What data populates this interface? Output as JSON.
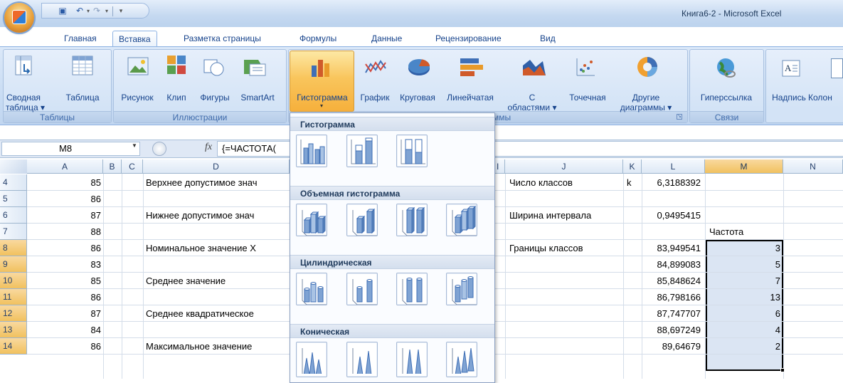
{
  "window": {
    "title": "Книга6-2 - Microsoft Excel"
  },
  "quick_access": [
    "save-icon",
    "undo-icon",
    "redo-icon",
    "customize-icon"
  ],
  "tabs": [
    {
      "label": "Главная",
      "active": false
    },
    {
      "label": "Вставка",
      "active": true
    },
    {
      "label": "Разметка страницы",
      "active": false
    },
    {
      "label": "Формулы",
      "active": false
    },
    {
      "label": "Данные",
      "active": false
    },
    {
      "label": "Рецензирование",
      "active": false
    },
    {
      "label": "Вид",
      "active": false
    }
  ],
  "ribbon": {
    "groups": [
      {
        "label": "Таблицы"
      },
      {
        "label": "Иллюстрации"
      },
      {
        "label": "Диаграммы"
      },
      {
        "label": "Связи"
      }
    ],
    "buttons": {
      "pivot_line1": "Сводная",
      "pivot_line2": "таблица ▾",
      "table": "Таблица",
      "picture": "Рисунок",
      "clip": "Клип",
      "shapes": "Фигуры",
      "smartart": "SmartArt",
      "column": "Гистограмма",
      "line": "График",
      "pie": "Круговая",
      "bar": "Линейчатая",
      "area_line1": "С",
      "area_line2": "областями ▾",
      "scatter": "Точечная",
      "other_line1": "Другие",
      "other_line2": "диаграммы ▾",
      "hyperlink": "Гиперссылка",
      "textbox": "Надпись",
      "header": "Колон"
    }
  },
  "formula_bar": {
    "name_box": "M8",
    "fx": "fx",
    "formula": "{=ЧАСТОТА("
  },
  "columns": [
    "A",
    "B",
    "C",
    "D",
    "I",
    "J",
    "K",
    "L",
    "M",
    "N"
  ],
  "rows": [
    {
      "num": "4",
      "A": "85",
      "D": "Верхнее допустимое знач",
      "J": "Число классов",
      "K": "k",
      "L": "6,3188392",
      "M": ""
    },
    {
      "num": "5",
      "A": "86",
      "D": "",
      "J": "",
      "K": "",
      "L": "",
      "M": ""
    },
    {
      "num": "6",
      "A": "87",
      "D": "Нижнее допустимое знач",
      "J": "Ширина интервала",
      "K": "",
      "L": "0,9495415",
      "M": ""
    },
    {
      "num": "7",
      "A": "88",
      "D": "",
      "J": "",
      "K": "",
      "L": "",
      "M": "Частота"
    },
    {
      "num": "8",
      "A": "86",
      "D": "Номинальное значение Х",
      "J": "Границы классов",
      "K": "",
      "L": "83,949541",
      "M": "3"
    },
    {
      "num": "9",
      "A": "83",
      "D": "",
      "J": "",
      "K": "",
      "L": "84,899083",
      "M": "5"
    },
    {
      "num": "10",
      "A": "85",
      "D": "Среднее значение",
      "J": "",
      "K": "",
      "L": "85,848624",
      "M": "7"
    },
    {
      "num": "11",
      "A": "86",
      "D": "",
      "J": "",
      "K": "",
      "L": "86,798166",
      "M": "13"
    },
    {
      "num": "12",
      "A": "87",
      "D": "Среднее квадратическое",
      "J": "",
      "K": "",
      "L": "87,747707",
      "M": "6"
    },
    {
      "num": "13",
      "A": "84",
      "D": "",
      "J": "",
      "K": "",
      "L": "88,697249",
      "M": "4"
    },
    {
      "num": "14",
      "A": "86",
      "D": "Максимальное значение",
      "J": "",
      "K": "",
      "L": "89,64679",
      "M": "2"
    }
  ],
  "dropdown": {
    "sections": [
      {
        "title": "Гистограмма",
        "items": [
          "clustered-column",
          "stacked-column",
          "100-stacked-column"
        ]
      },
      {
        "title": "Объемная гистограмма",
        "items": [
          "3d-clustered-column",
          "3d-stacked-column",
          "3d-100-stacked-column",
          "3d-column"
        ]
      },
      {
        "title": "Цилиндрическая",
        "items": [
          "clustered-cylinder",
          "stacked-cylinder",
          "100-stacked-cylinder",
          "3d-cylinder"
        ]
      },
      {
        "title": "Коническая",
        "items": [
          "clustered-cone",
          "stacked-cone",
          "100-stacked-cone",
          "3d-cone"
        ]
      }
    ]
  },
  "colors": {
    "ribbon": "#c7dbf3",
    "selection": "#dbe5f3",
    "header_selected": "#f1c15f"
  }
}
